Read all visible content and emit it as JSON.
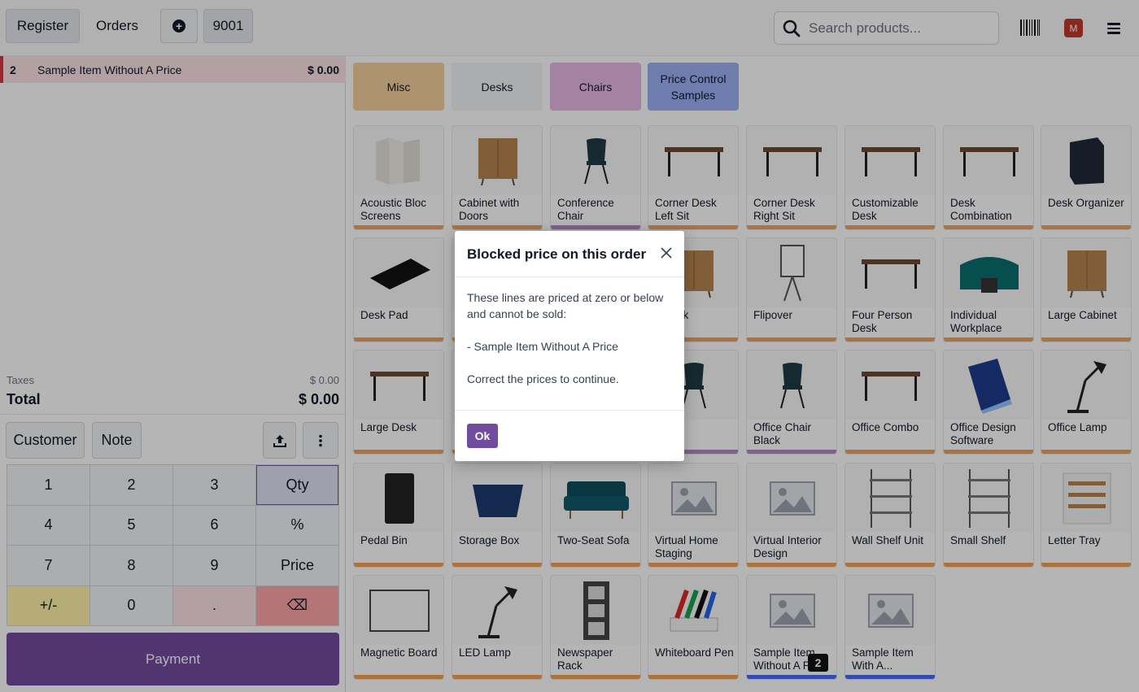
{
  "header": {
    "register_label": "Register",
    "orders_label": "Orders",
    "add_icon": "plus-circle-icon",
    "order_number": "9001",
    "search_placeholder": "Search products...",
    "avatar_letter": "M"
  },
  "order": {
    "lines": [
      {
        "qty": "2",
        "name": "Sample Item Without A Price",
        "price": "$ 0.00"
      }
    ],
    "taxes_label": "Taxes",
    "taxes_value": "$ 0.00",
    "total_label": "Total",
    "total_value": "$ 0.00"
  },
  "actions": {
    "customer_label": "Customer",
    "note_label": "Note"
  },
  "numpad": {
    "keys": [
      "1",
      "2",
      "3",
      "Qty",
      "4",
      "5",
      "6",
      "%",
      "7",
      "8",
      "9",
      "Price",
      "+/-",
      "0",
      ".",
      "⌫"
    ]
  },
  "payment_label": "Payment",
  "categories": [
    {
      "label": "Misc",
      "color": "#f5cfa0"
    },
    {
      "label": "Desks",
      "color": "#f3f4f6"
    },
    {
      "label": "Chairs",
      "color": "#e6b8e4"
    },
    {
      "label": "Price Control Samples",
      "color": "#9db0f5"
    }
  ],
  "products": [
    {
      "name": "Acoustic Bloc Screens",
      "bar": "orange"
    },
    {
      "name": "Cabinet with Doors",
      "bar": "orange"
    },
    {
      "name": "Conference Chair",
      "bar": "purple"
    },
    {
      "name": "Corner Desk Left Sit",
      "bar": "orange"
    },
    {
      "name": "Corner Desk Right Sit",
      "bar": "orange"
    },
    {
      "name": "Customizable Desk",
      "bar": "orange"
    },
    {
      "name": "Desk Combination",
      "bar": "orange"
    },
    {
      "name": "Desk Organizer",
      "bar": "orange"
    },
    {
      "name": "Desk Pad",
      "bar": "orange"
    },
    {
      "name": "",
      "bar": "orange"
    },
    {
      "name": "",
      "bar": "orange"
    },
    {
      "name": "r Black",
      "bar": "orange"
    },
    {
      "name": "Flipover",
      "bar": "orange"
    },
    {
      "name": "Four Person Desk",
      "bar": "orange"
    },
    {
      "name": "Individual Workplace",
      "bar": "orange"
    },
    {
      "name": "Large Cabinet",
      "bar": "orange"
    },
    {
      "name": "Large Desk",
      "bar": "orange"
    },
    {
      "name": "",
      "bar": "orange"
    },
    {
      "name": "",
      "bar": "orange"
    },
    {
      "name": "Chair",
      "bar": "purple"
    },
    {
      "name": "Office Chair Black",
      "bar": "purple"
    },
    {
      "name": "Office Combo",
      "bar": "orange"
    },
    {
      "name": "Office Design Software",
      "bar": "orange"
    },
    {
      "name": "Office Lamp",
      "bar": "orange"
    },
    {
      "name": "Pedal Bin",
      "bar": "orange"
    },
    {
      "name": "Storage Box",
      "bar": "orange"
    },
    {
      "name": "Two-Seat Sofa",
      "bar": "orange"
    },
    {
      "name": "Virtual Home Staging",
      "bar": "orange"
    },
    {
      "name": "Virtual Interior Design",
      "bar": "orange"
    },
    {
      "name": "Wall Shelf Unit",
      "bar": "orange"
    },
    {
      "name": "Small Shelf",
      "bar": "orange"
    },
    {
      "name": "Letter Tray",
      "bar": "orange"
    },
    {
      "name": "Magnetic Board",
      "bar": "orange"
    },
    {
      "name": "LED Lamp",
      "bar": "orange"
    },
    {
      "name": "Newspaper Rack",
      "bar": "orange"
    },
    {
      "name": "Whiteboard Pen",
      "bar": "orange"
    },
    {
      "name": "Sample Item Without A Pr",
      "bar": "blue",
      "badge": "2"
    },
    {
      "name": "Sample Item With A...",
      "bar": "blue"
    }
  ],
  "dialog": {
    "title": "Blocked price on this order",
    "line1": "These lines are priced at zero or below and cannot be sold:",
    "line2": "- Sample Item Without A Price",
    "line3": "Correct the prices to continue.",
    "ok_label": "Ok"
  }
}
